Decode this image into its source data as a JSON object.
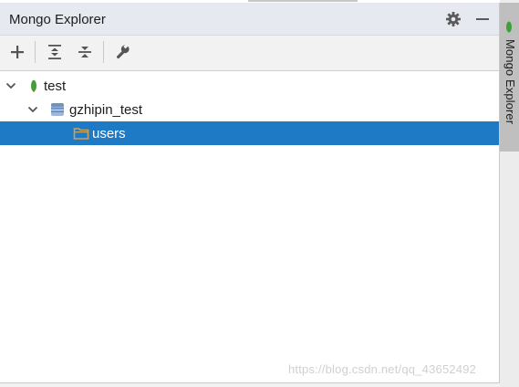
{
  "panel": {
    "title": "Mongo Explorer",
    "header_icons": [
      "gear-icon",
      "minimize-icon"
    ]
  },
  "toolbar": {
    "buttons": [
      {
        "icon": "add-icon"
      },
      {
        "icon": "expand-all-icon"
      },
      {
        "icon": "collapse-all-icon"
      },
      {
        "icon": "wrench-icon"
      }
    ]
  },
  "tree": {
    "items": [
      {
        "label": "test",
        "icon": "mongo-leaf-icon",
        "expanded": true,
        "level": 0
      },
      {
        "label": "gzhipin_test",
        "icon": "database-icon",
        "expanded": true,
        "level": 1
      },
      {
        "label": "users",
        "icon": "folder-icon",
        "selected": true,
        "level": 2
      }
    ]
  },
  "side_tab": {
    "label": "Mongo Explorer",
    "icon": "mongo-leaf-icon"
  },
  "watermark": "https://blog.csdn.net/qq_43652492",
  "colors": {
    "selection": "#1f7ac6",
    "header_bg": "#e6e9f0",
    "mongo_green": "#3fa037",
    "folder": "#c9a25a"
  }
}
